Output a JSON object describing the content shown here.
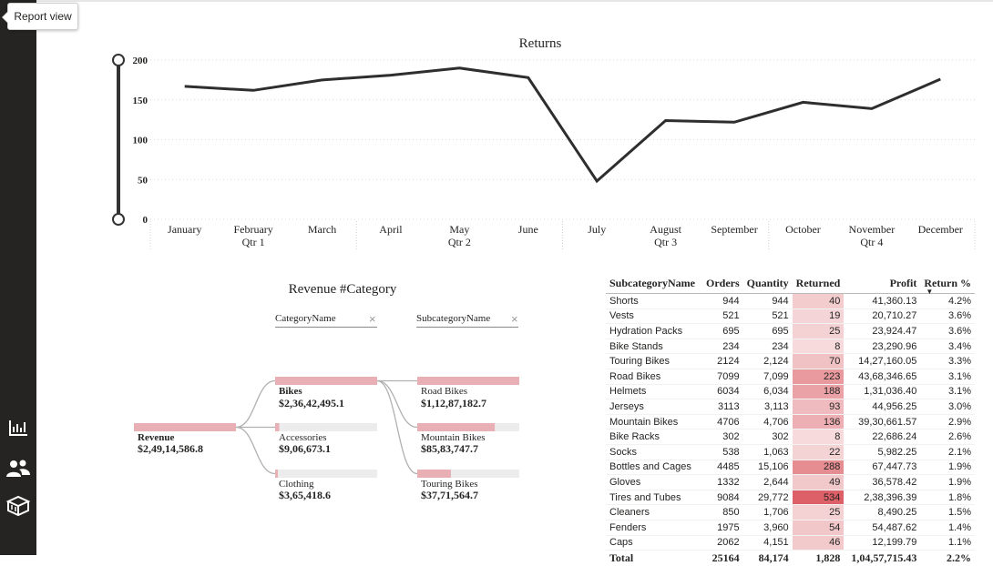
{
  "tooltip": {
    "text": "Report view"
  },
  "sidebar": {
    "icons": [
      "report-view-icon",
      "model-view-icon",
      "data-view-icon"
    ],
    "colors": {
      "background": "#252423",
      "icon": "#ffffff"
    }
  },
  "chart_data": [
    {
      "type": "line",
      "title": "Returns",
      "xlabel": "",
      "ylabel": "",
      "categories": [
        "January",
        "February",
        "March",
        "April",
        "May",
        "June",
        "July",
        "August",
        "September",
        "October",
        "November",
        "December"
      ],
      "quarter_labels": [
        {
          "label": "Qtr 1",
          "month": "February"
        },
        {
          "label": "Qtr 2",
          "month": "May"
        },
        {
          "label": "Qtr 3",
          "month": "August"
        },
        {
          "label": "Qtr 4",
          "month": "November"
        }
      ],
      "values": [
        167,
        162,
        175,
        181,
        190,
        178,
        48,
        124,
        122,
        147,
        139,
        176
      ],
      "ylim": [
        0,
        200
      ],
      "yticks": [
        "200",
        "150",
        "100",
        "50",
        "0"
      ],
      "grid": true,
      "legend": "none",
      "line_color": "#2e2e2e"
    },
    {
      "type": "decomposition-tree",
      "title": "Revenue #Category",
      "levels": [
        "CategoryName",
        "SubcategoryName"
      ],
      "root": {
        "label": "Revenue",
        "value": "$2,49,14,586.8",
        "fraction": 1.0
      },
      "categories": [
        {
          "label": "Bikes",
          "value": "$2,36,42,495.1",
          "fraction": 1.0
        },
        {
          "label": "Accessories",
          "value": "$9,06,673.1",
          "fraction": 0.04
        },
        {
          "label": "Clothing",
          "value": "$3,65,418.6",
          "fraction": 0.015
        }
      ],
      "subcategories": [
        {
          "label": "Road Bikes",
          "value": "$1,12,87,182.7",
          "fraction": 1.0
        },
        {
          "label": "Mountain Bikes",
          "value": "$85,83,747.7",
          "fraction": 0.76
        },
        {
          "label": "Touring Bikes",
          "value": "$37,71,564.7",
          "fraction": 0.33
        }
      ],
      "bar_color": "#e8b0b5",
      "track_color": "#ececec"
    }
  ],
  "table": {
    "columns": [
      "SubcategoryName",
      "Orders",
      "Quantity",
      "Returned",
      "Profit",
      "Return %"
    ],
    "sorted_column": "Return %",
    "rows": [
      {
        "name": "Shorts",
        "orders": "944",
        "quantity": "944",
        "returned": "40",
        "returned_num": 40,
        "profit": "41,360.13",
        "pct": "4.2%"
      },
      {
        "name": "Vests",
        "orders": "521",
        "quantity": "521",
        "returned": "19",
        "returned_num": 19,
        "profit": "20,710.27",
        "pct": "3.6%"
      },
      {
        "name": "Hydration Packs",
        "orders": "695",
        "quantity": "695",
        "returned": "25",
        "returned_num": 25,
        "profit": "23,924.47",
        "pct": "3.6%"
      },
      {
        "name": "Bike Stands",
        "orders": "234",
        "quantity": "234",
        "returned": "8",
        "returned_num": 8,
        "profit": "23,290.96",
        "pct": "3.4%"
      },
      {
        "name": "Touring Bikes",
        "orders": "2124",
        "quantity": "2,124",
        "returned": "70",
        "returned_num": 70,
        "profit": "14,27,160.05",
        "pct": "3.3%"
      },
      {
        "name": "Road Bikes",
        "orders": "7099",
        "quantity": "7,099",
        "returned": "223",
        "returned_num": 223,
        "profit": "43,68,346.65",
        "pct": "3.1%"
      },
      {
        "name": "Helmets",
        "orders": "6034",
        "quantity": "6,034",
        "returned": "188",
        "returned_num": 188,
        "profit": "1,31,036.40",
        "pct": "3.1%"
      },
      {
        "name": "Jerseys",
        "orders": "3113",
        "quantity": "3,113",
        "returned": "93",
        "returned_num": 93,
        "profit": "44,956.25",
        "pct": "3.0%"
      },
      {
        "name": "Mountain Bikes",
        "orders": "4706",
        "quantity": "4,706",
        "returned": "136",
        "returned_num": 136,
        "profit": "39,30,661.57",
        "pct": "2.9%"
      },
      {
        "name": "Bike Racks",
        "orders": "302",
        "quantity": "302",
        "returned": "8",
        "returned_num": 8,
        "profit": "22,686.24",
        "pct": "2.6%"
      },
      {
        "name": "Socks",
        "orders": "538",
        "quantity": "1,063",
        "returned": "22",
        "returned_num": 22,
        "profit": "5,982.25",
        "pct": "2.1%"
      },
      {
        "name": "Bottles and Cages",
        "orders": "4485",
        "quantity": "15,106",
        "returned": "288",
        "returned_num": 288,
        "profit": "67,447.73",
        "pct": "1.9%"
      },
      {
        "name": "Gloves",
        "orders": "1332",
        "quantity": "2,644",
        "returned": "49",
        "returned_num": 49,
        "profit": "36,578.42",
        "pct": "1.9%"
      },
      {
        "name": "Tires and Tubes",
        "orders": "9084",
        "quantity": "29,772",
        "returned": "534",
        "returned_num": 534,
        "profit": "2,38,396.39",
        "pct": "1.8%"
      },
      {
        "name": "Cleaners",
        "orders": "850",
        "quantity": "1,706",
        "returned": "25",
        "returned_num": 25,
        "profit": "8,490.25",
        "pct": "1.5%"
      },
      {
        "name": "Fenders",
        "orders": "1975",
        "quantity": "3,960",
        "returned": "54",
        "returned_num": 54,
        "profit": "54,487.62",
        "pct": "1.4%"
      },
      {
        "name": "Caps",
        "orders": "2062",
        "quantity": "4,151",
        "returned": "46",
        "returned_num": 46,
        "profit": "12,199.79",
        "pct": "1.1%"
      }
    ],
    "total": {
      "name": "Total",
      "orders": "25164",
      "quantity": "84,174",
      "returned": "1,828",
      "profit": "1,04,57,715.43",
      "pct": "2.2%"
    },
    "heat_color_low": "#f7e1e2",
    "heat_color_high": "#dd5f67"
  }
}
